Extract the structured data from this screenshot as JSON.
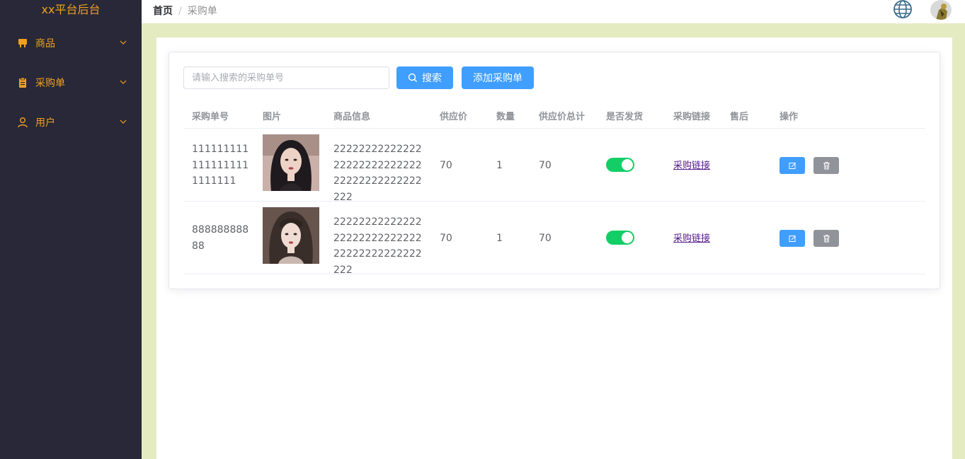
{
  "app": {
    "title": "xx平台后台"
  },
  "sidebar": {
    "items": [
      {
        "label": "商品",
        "icon": "shop-icon"
      },
      {
        "label": "采购单",
        "icon": "clipboard-icon"
      },
      {
        "label": "用户",
        "icon": "user-icon"
      }
    ]
  },
  "breadcrumb": {
    "home": "首页",
    "separator": "/",
    "current": "采购单"
  },
  "header": {
    "language_icon": "globe-icon",
    "avatar_icon": "avatar"
  },
  "search": {
    "placeholder": "请输入搜索的采购单号",
    "button_label": "搜索",
    "add_label": "添加采购单"
  },
  "table": {
    "columns": [
      "采购单号",
      "图片",
      "商品信息",
      "供应价",
      "数量",
      "供应价总计",
      "是否发货",
      "采购链接",
      "售后",
      "操作"
    ],
    "rows": [
      {
        "order_no": "1111111111111111111111111",
        "product_info": "222222222222222222222222222222222222222222222",
        "price": "70",
        "quantity": "1",
        "total": "70",
        "shipped": true,
        "link_label": "采购链接",
        "after_sale": ""
      },
      {
        "order_no": "88888888888",
        "product_info": "222222222222222222222222222222222222222222222",
        "price": "70",
        "quantity": "1",
        "total": "70",
        "shipped": true,
        "link_label": "采购链接",
        "after_sale": ""
      }
    ]
  },
  "colors": {
    "sidebar_bg": "#282838",
    "accent": "#f0a020",
    "primary": "#409eff",
    "switch_on": "#13ce66",
    "content_bg": "#e4ebc1"
  }
}
